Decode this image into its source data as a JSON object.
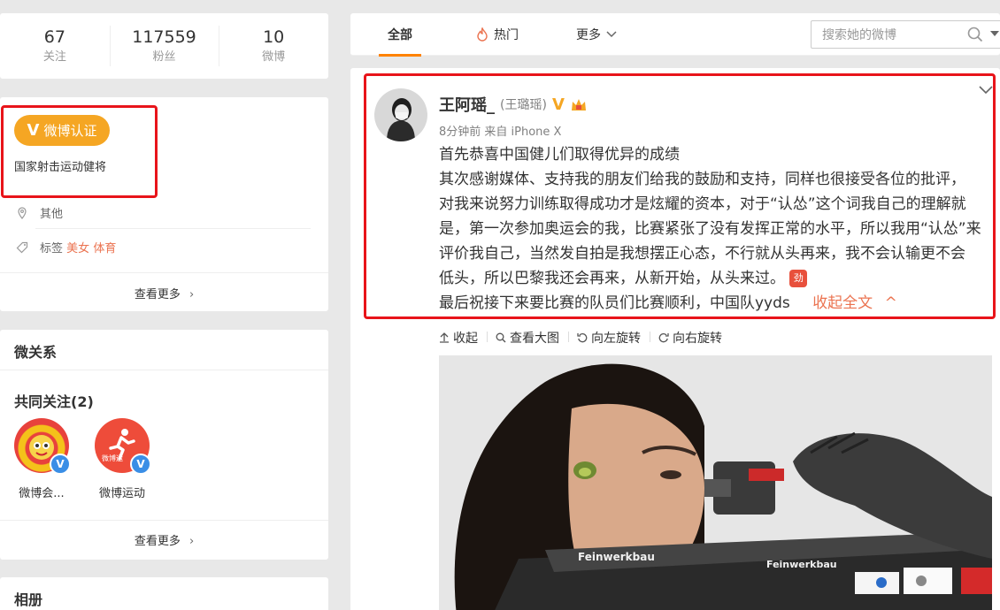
{
  "stats": [
    {
      "value": "67",
      "label": "关注"
    },
    {
      "value": "117559",
      "label": "粉丝"
    },
    {
      "value": "10",
      "label": "微博"
    }
  ],
  "profile": {
    "verify_label": "微博认证",
    "verify_desc": "国家射击运动健将",
    "location": "其他",
    "tags_label": "标签",
    "tags": [
      "美女",
      "体育"
    ],
    "more": "查看更多"
  },
  "relations": {
    "title": "微关系",
    "common_follow": "共同关注(2)",
    "items": [
      {
        "name": "微博会..."
      },
      {
        "name": "微博运动",
        "avatar_text": "微博运"
      }
    ],
    "more": "查看更多"
  },
  "album": {
    "title": "相册"
  },
  "tabs": {
    "all": "全部",
    "hot": "热门",
    "more": "更多",
    "search_placeholder": "搜索她的微博"
  },
  "post": {
    "nickname": "王阿瑶_",
    "remark": "(王璐瑶)",
    "meta": "8分钟前 来自 iPhone X",
    "lines": [
      "首先恭喜中国健儿们取得优异的成绩",
      "其次感谢媒体、支持我的朋友们给我的鼓励和支持，同样也很接受各位的批评，",
      "对我来说努力训练取得成功才是炫耀的资本，对于“认怂”这个词我自己的理解就",
      "是，第一次参加奥运会的我，比赛紧张了没有发挥正常的水平，所以我用“认怂”来",
      "评价我自己，当然发自拍是我想摆正心态，不行就从头再来，我不会认输更不会",
      "低头，所以巴黎我还会再来，从新开始，从头来过。",
      "最后祝接下来要比赛的队员们比赛顺利，中国队yyds"
    ],
    "emoji_text": "劲",
    "collapse": "收起全文",
    "toolbar": [
      "收起",
      "查看大图",
      "向左旋转",
      "向右旋转"
    ],
    "image_text": [
      "Feinwerkbau",
      "Feinwerkbau"
    ]
  },
  "colors": {
    "accent": "#ff8200",
    "link": "#eb7350",
    "verify": "#f5a623",
    "annotation": "#e8141a"
  }
}
